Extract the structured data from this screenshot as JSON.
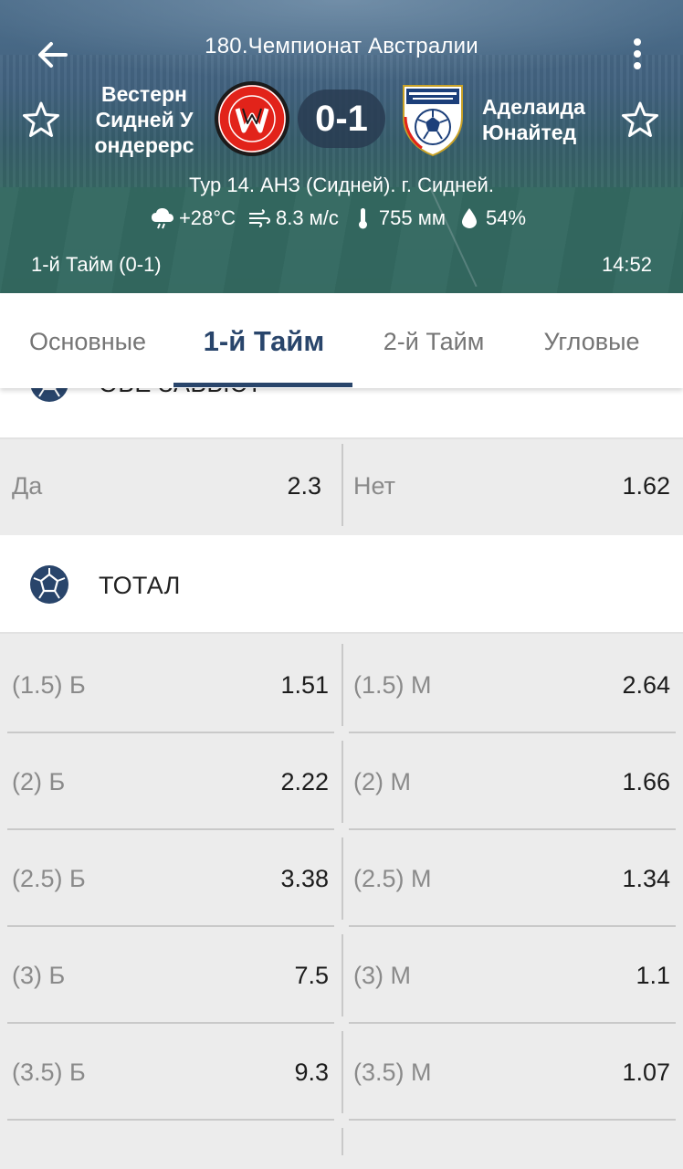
{
  "header": {
    "league_title": "180.Чемпионат Австралии",
    "home_team": "Вестерн Сидней У ондерерс",
    "away_team": "Аделаида Юнайтед",
    "score": "0-1",
    "venue": "Тур 14. АНЗ (Сидней). г. Сидней.",
    "weather": {
      "temperature": "+28°C",
      "wind": "8.3 м/с",
      "pressure": "755 мм",
      "humidity": "54%"
    },
    "half_score": "1-й  Тайм (0-1)",
    "time": "14:52",
    "colors": {
      "score_bg": "#283a50",
      "home_logo": "#e2231a",
      "away_logo": "#1c3f7a"
    }
  },
  "tabs": [
    {
      "label": "Основные",
      "active": false
    },
    {
      "label": "1-й  Тайм",
      "active": true
    },
    {
      "label": "2-й  Тайм",
      "active": false
    },
    {
      "label": "Угловые",
      "active": false
    }
  ],
  "sections": {
    "both_score": {
      "title": "ОБЕ ЗАБЬЮТ",
      "rows": [
        {
          "left_label": "Да",
          "left_odd": "2.3",
          "right_label": "Нет",
          "right_odd": "1.62"
        }
      ]
    },
    "total": {
      "title": "ТОТАЛ",
      "rows": [
        {
          "left_label": "(1.5) Б",
          "left_odd": "1.51",
          "right_label": "(1.5) М",
          "right_odd": "2.64"
        },
        {
          "left_label": "(2) Б",
          "left_odd": "2.22",
          "right_label": "(2) М",
          "right_odd": "1.66"
        },
        {
          "left_label": "(2.5) Б",
          "left_odd": "3.38",
          "right_label": "(2.5) М",
          "right_odd": "1.34"
        },
        {
          "left_label": "(3) Б",
          "left_odd": "7.5",
          "right_label": "(3) М",
          "right_odd": "1.1"
        },
        {
          "left_label": "(3.5) Б",
          "left_odd": "9.3",
          "right_label": "(3.5) М",
          "right_odd": "1.07"
        }
      ]
    }
  },
  "colors": {
    "accent": "#29456b",
    "inactive_tab": "#757575",
    "content_bg": "#ececec",
    "ball": "#29456b"
  }
}
